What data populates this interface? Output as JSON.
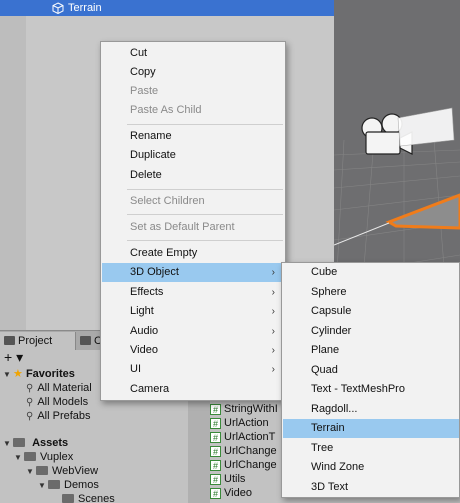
{
  "hierarchy": {
    "selected_item": "Terrain"
  },
  "project": {
    "tabs": {
      "project": "Project",
      "console": "C"
    },
    "add_label": "+ ▾",
    "tree": {
      "favorites": {
        "label": "Favorites",
        "items": [
          "All Material",
          "All Models",
          "All Prefabs"
        ]
      },
      "assets": {
        "label": "Assets",
        "children": [
          {
            "label": "Vuplex"
          },
          {
            "label": "WebView"
          },
          {
            "label": "Demos"
          },
          {
            "label": "Scenes"
          }
        ]
      }
    },
    "files": [
      "StringWithI",
      "UrlAction",
      "UrlActionT",
      "UrlChange",
      "UrlChange",
      "Utils",
      "Video"
    ]
  },
  "context_menu": {
    "items": [
      {
        "label": "Cut",
        "disabled": false
      },
      {
        "label": "Copy",
        "disabled": false
      },
      {
        "label": "Paste",
        "disabled": true
      },
      {
        "label": "Paste As Child",
        "disabled": true
      },
      {
        "label": "Rename",
        "disabled": false
      },
      {
        "label": "Duplicate",
        "disabled": false
      },
      {
        "label": "Delete",
        "disabled": false
      },
      {
        "label": "Select Children",
        "disabled": true
      },
      {
        "label": "Set as Default Parent",
        "disabled": true
      },
      {
        "label": "Create Empty",
        "disabled": false
      },
      {
        "label": "3D Object",
        "disabled": false,
        "submenu": true,
        "highlighted": true
      },
      {
        "label": "Effects",
        "disabled": false,
        "submenu": true
      },
      {
        "label": "Light",
        "disabled": false,
        "submenu": true
      },
      {
        "label": "Audio",
        "disabled": false,
        "submenu": true
      },
      {
        "label": "Video",
        "disabled": false,
        "submenu": true
      },
      {
        "label": "UI",
        "disabled": false,
        "submenu": true
      },
      {
        "label": "Camera",
        "disabled": false
      }
    ],
    "submenu_arrow": "›"
  },
  "submenu_3d": {
    "items": [
      "Cube",
      "Sphere",
      "Capsule",
      "Cylinder",
      "Plane",
      "Quad",
      "Text - TextMeshPro",
      "Ragdoll...",
      "Terrain",
      "Tree",
      "Wind Zone",
      "3D Text"
    ],
    "highlighted": "Terrain"
  },
  "colors": {
    "selection_blue": "#3a72d0",
    "menu_highlight": "#99c9ef",
    "terrain_outline": "#f07c1a"
  }
}
